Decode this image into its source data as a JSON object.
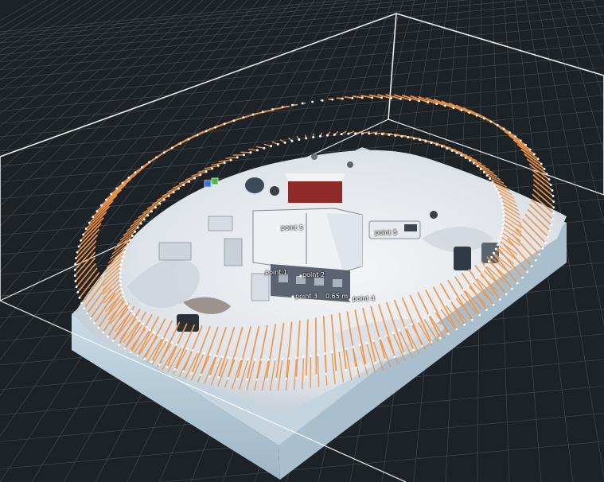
{
  "viewport": {
    "background": "#1d2226",
    "grid_color": "#6b7780",
    "bounding_box_color": "#ffffff",
    "flight_path_color": "#ffffff",
    "camera_ray_color": "#f0964a",
    "terrain_color": "#e8ecf0",
    "base_block_color": "#b9cedc"
  },
  "markers": {
    "point1": "point 1",
    "point2": "point 2",
    "point3": "point 3",
    "point3_distance": "0.65 m",
    "point4": "point 4",
    "point5": "point 5",
    "point_top": "point 5"
  },
  "icons": [
    "cube-gizmo-icon",
    "measure-icon"
  ]
}
